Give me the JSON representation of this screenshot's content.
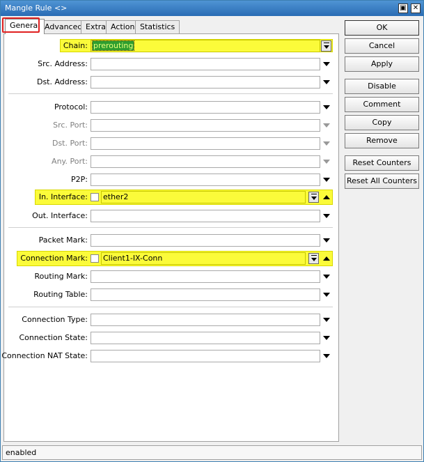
{
  "window": {
    "title": "Mangle Rule <>",
    "restore_glyph": "▣",
    "close_glyph": "✕"
  },
  "tabs": [
    "General",
    "Advanced",
    "Extra",
    "Action",
    "Statistics"
  ],
  "fields": {
    "chain": {
      "label": "Chain:",
      "value": "prerouting"
    },
    "src_address": {
      "label": "Src. Address:"
    },
    "dst_address": {
      "label": "Dst. Address:"
    },
    "protocol": {
      "label": "Protocol:"
    },
    "src_port": {
      "label": "Src. Port:"
    },
    "dst_port": {
      "label": "Dst. Port:"
    },
    "any_port": {
      "label": "Any. Port:"
    },
    "p2p": {
      "label": "P2P:"
    },
    "in_interface": {
      "label": "In. Interface:",
      "value": "ether2"
    },
    "out_interface": {
      "label": "Out. Interface:"
    },
    "packet_mark": {
      "label": "Packet Mark:"
    },
    "connection_mark": {
      "label": "Connection Mark:",
      "value": "Client1-IX-Conn"
    },
    "routing_mark": {
      "label": "Routing Mark:"
    },
    "routing_table": {
      "label": "Routing Table:"
    },
    "connection_type": {
      "label": "Connection Type:"
    },
    "connection_state": {
      "label": "Connection State:"
    },
    "connection_nat_state": {
      "label": "Connection NAT State:"
    }
  },
  "buttons": {
    "ok": "OK",
    "cancel": "Cancel",
    "apply": "Apply",
    "disable": "Disable",
    "comment": "Comment",
    "copy": "Copy",
    "remove": "Remove",
    "reset_counters": "Reset Counters",
    "reset_all_counters": "Reset All Counters"
  },
  "status": "enabled",
  "colors": {
    "highlight": "#fbfb3a",
    "tab_outline": "#e02020",
    "title_bar": "#2a6cb4"
  }
}
